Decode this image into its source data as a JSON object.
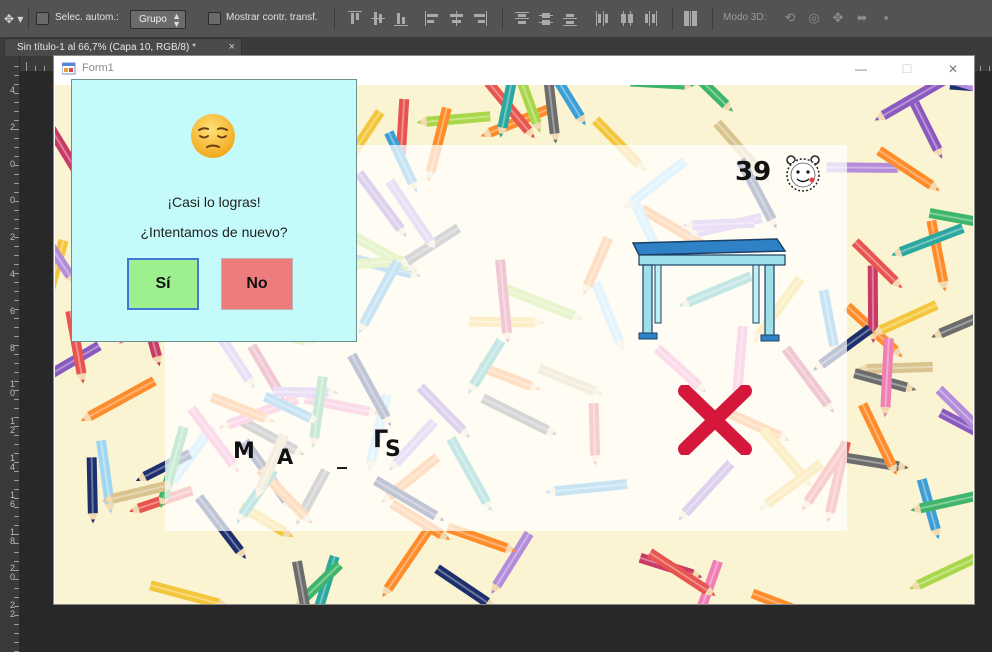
{
  "photoshop": {
    "auto_select_label": "Selec. autom.:",
    "auto_select_value": "Grupo",
    "show_transform_label": "Mostrar contr. transf.",
    "mode_3d_label": "Modo 3D:",
    "doc_tab_title": "Sin título-1 al 66,7% (Capa 10, RGB/8) *",
    "doc_tab_close": "×",
    "ruler_left_numbers": [
      "4",
      "2",
      "0",
      "0",
      "2",
      "4",
      "6",
      "8",
      "1 0",
      "1 2",
      "1 4",
      "1 6",
      "1 8",
      "2 0",
      "2 2"
    ]
  },
  "form": {
    "title": "Form1",
    "minimize": "—",
    "maximize": "☐",
    "close": "✕",
    "timer_value": "39",
    "word_letters": [
      "M",
      "A",
      "_",
      "Γ",
      "S"
    ]
  },
  "dialog": {
    "line1": "¡Casi lo logras!",
    "line2": "¿Intentamos de nuevo?",
    "yes_label": "Sí",
    "no_label": "No"
  },
  "colors": {
    "dialog_bg": "#c4fbfa",
    "yes_bg": "#9ef08f",
    "no_bg": "#ef7c7c",
    "wrong_x": "#d6173c",
    "table_top": "#2e7fc0",
    "background": "#fbf4d2"
  },
  "icons": {
    "move_tool": "move-arrows-icon",
    "emoji": "sad-face-icon",
    "clock": "alarm-clock-icon",
    "wrong": "red-x-icon",
    "table": "desk-table-image"
  }
}
